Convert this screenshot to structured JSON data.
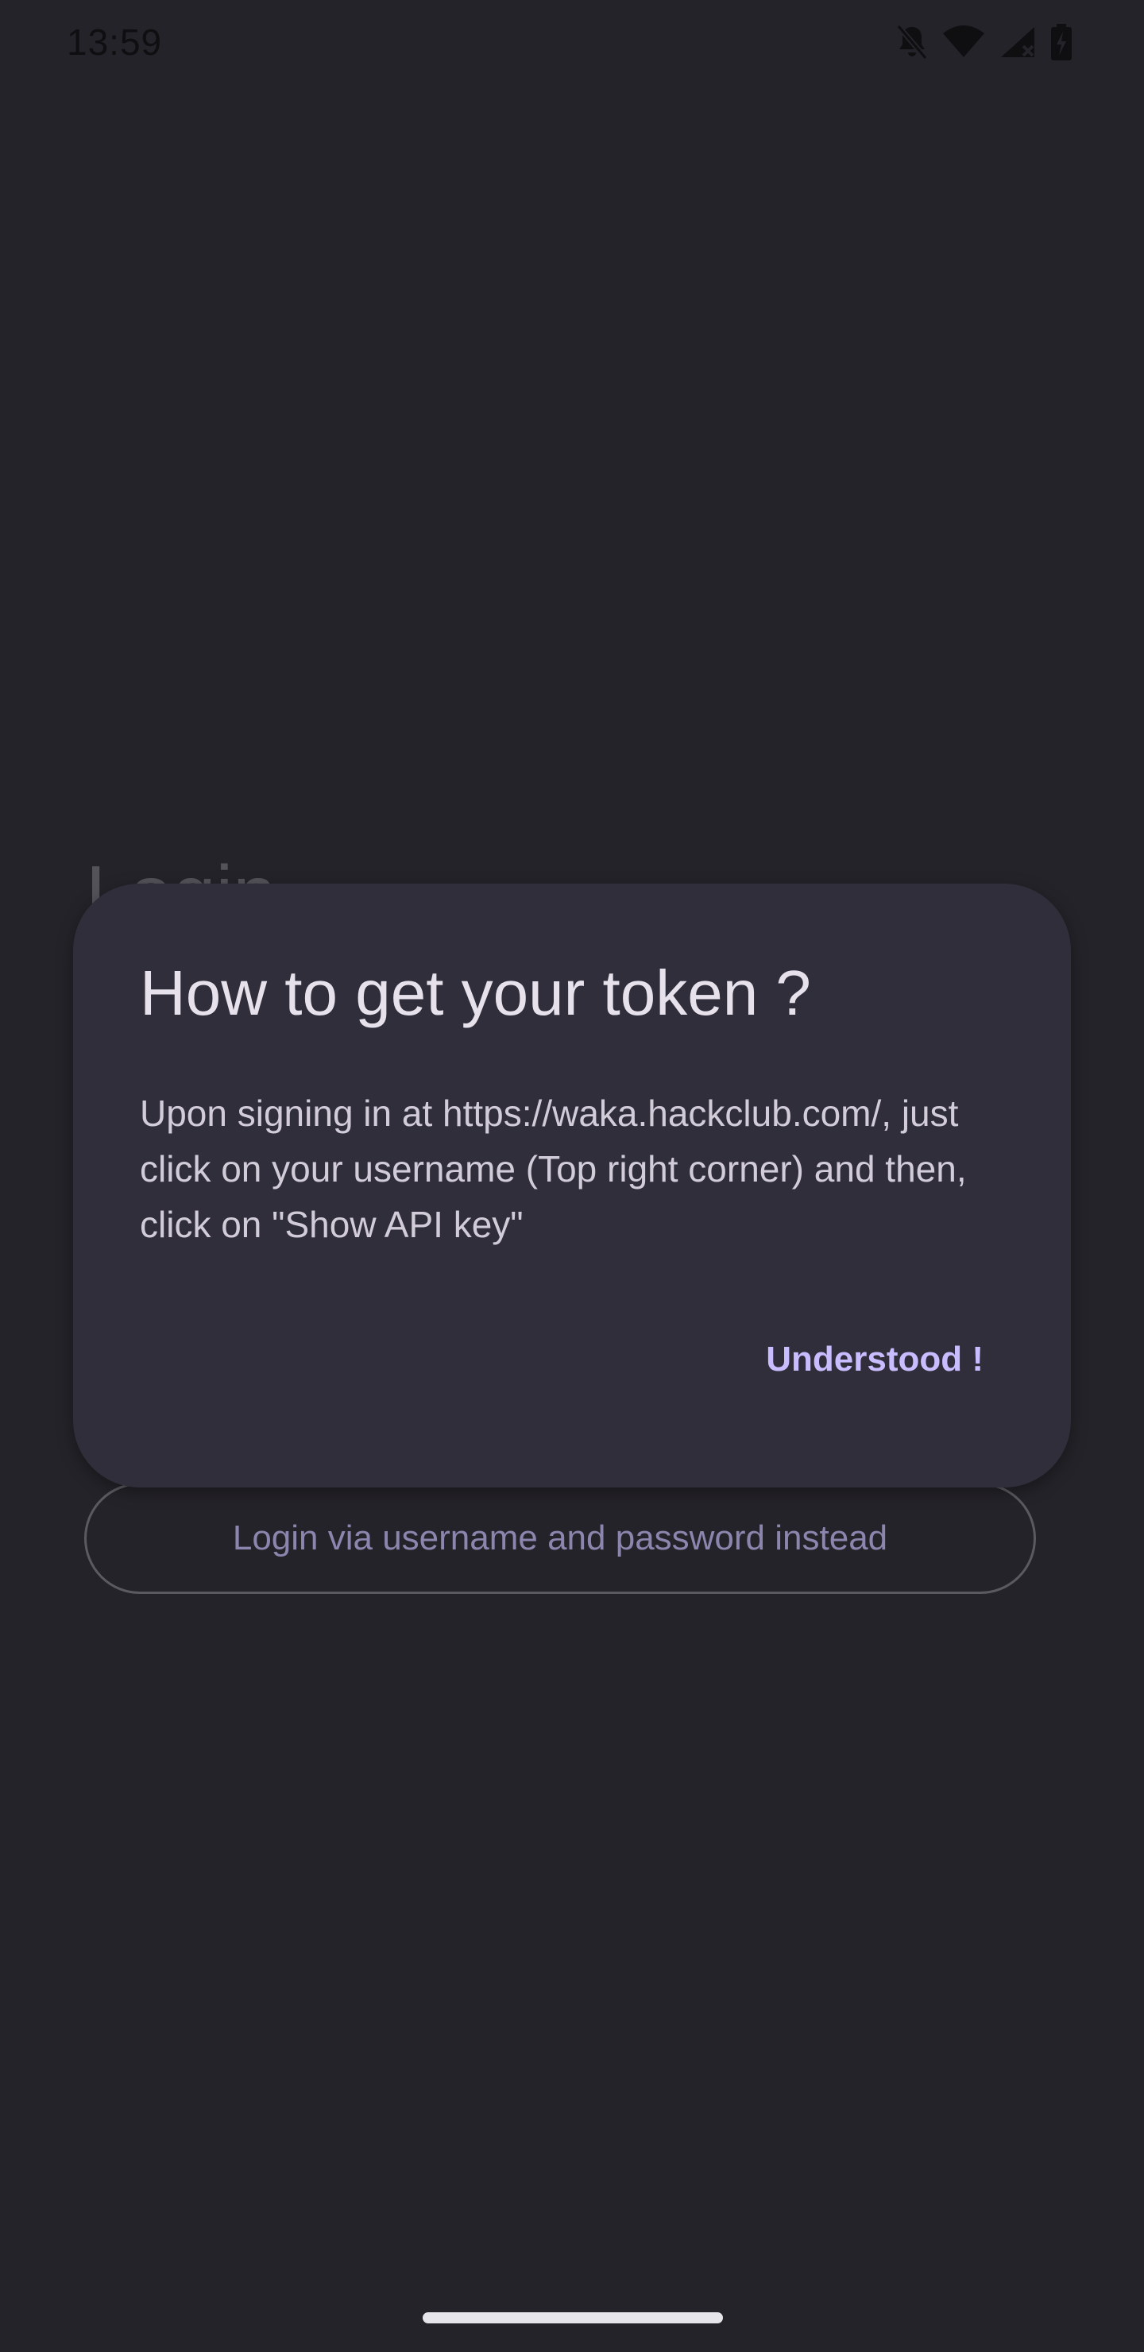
{
  "status_bar": {
    "time": "13:59",
    "icons": [
      "bell-off-icon",
      "wifi-icon",
      "signal-icon",
      "battery-charging-icon"
    ]
  },
  "background": {
    "page_title": "Login",
    "alt_login_button": "Login via username and password instead"
  },
  "dialog": {
    "title": "How to get your token ?",
    "body": "Upon signing in at https://waka.hackclub.com/, just click on your username (Top right corner) and then, click on \"Show API key\"",
    "confirm_button": "Understood !"
  },
  "colors": {
    "background": "#242329",
    "dialog_surface": "#302e3b",
    "accent": "#c9bcff",
    "outline_button_text": "#8c85ad"
  }
}
